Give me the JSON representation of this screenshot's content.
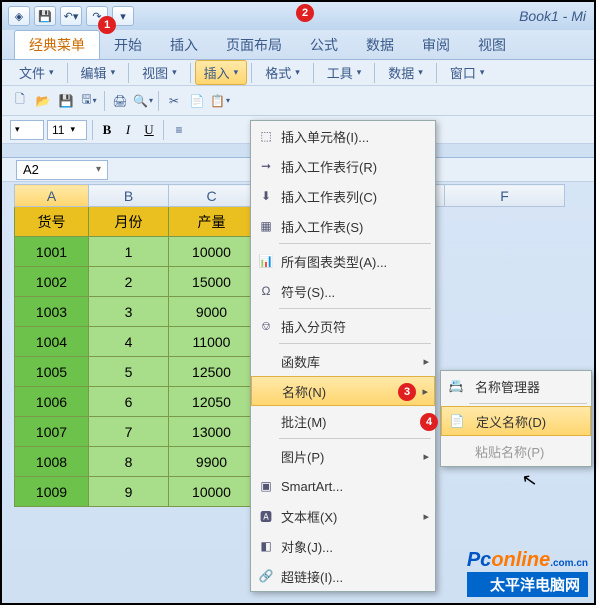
{
  "title_suffix": "Book1 - Mi",
  "ribbon": [
    "经典菜单",
    "开始",
    "插入",
    "页面布局",
    "公式",
    "数据",
    "审阅",
    "视图"
  ],
  "toolbar_menus": [
    "文件",
    "编辑",
    "视图",
    "插入",
    "格式",
    "工具",
    "数据",
    "窗口"
  ],
  "font_size": "11",
  "bold": "B",
  "italic": "I",
  "underline": "U",
  "namebox": "A2",
  "markers": {
    "m1": "1",
    "m2": "2",
    "m3": "3",
    "m4": "4"
  },
  "col_headers": [
    "A",
    "B",
    "C",
    "F"
  ],
  "data_headers": [
    "货号",
    "月份",
    "产量"
  ],
  "rows": [
    {
      "a": "1001",
      "b": "1",
      "c": "10000"
    },
    {
      "a": "1002",
      "b": "2",
      "c": "15000"
    },
    {
      "a": "1003",
      "b": "3",
      "c": "9000"
    },
    {
      "a": "1004",
      "b": "4",
      "c": "11000"
    },
    {
      "a": "1005",
      "b": "5",
      "c": "12500"
    },
    {
      "a": "1006",
      "b": "6",
      "c": "12050"
    },
    {
      "a": "1007",
      "b": "7",
      "c": "13000"
    },
    {
      "a": "1008",
      "b": "8",
      "c": "9900"
    },
    {
      "a": "1009",
      "b": "9",
      "c": "10000"
    }
  ],
  "menu": {
    "items": [
      {
        "label": "插入单元格(I)...",
        "icon": "⬚"
      },
      {
        "label": "插入工作表行(R)",
        "icon": "➞"
      },
      {
        "label": "插入工作表列(C)",
        "icon": "⬇"
      },
      {
        "label": "插入工作表(S)",
        "icon": "▦"
      },
      {
        "label": "所有图表类型(A)...",
        "icon": "📊"
      },
      {
        "label": "符号(S)...",
        "icon": "Ω"
      },
      {
        "label": "插入分页符",
        "icon": "⎊"
      },
      {
        "label": "函数库",
        "sub": true
      },
      {
        "label": "名称(N)",
        "sub": true,
        "hl": true
      },
      {
        "label": "批注(M)",
        "sub": true
      },
      {
        "label": "图片(P)",
        "sub": true
      },
      {
        "label": "SmartArt...",
        "icon": "▣"
      },
      {
        "label": "文本框(X)",
        "icon": "🅰",
        "sub": true
      },
      {
        "label": "对象(J)...",
        "icon": "◧"
      },
      {
        "label": "超链接(I)...",
        "icon": "🔗"
      }
    ]
  },
  "submenu": {
    "items": [
      {
        "label": "名称管理器",
        "icon": "📇"
      },
      {
        "label": "定义名称(D)",
        "icon": "📄",
        "hl": true
      },
      {
        "label": "粘贴名称(P)",
        "disabled": true
      }
    ]
  },
  "watermark": {
    "brand_a": "Pc",
    "brand_b": "online",
    "suffix": ".com.cn",
    "tagline": "太平洋电脑网"
  }
}
